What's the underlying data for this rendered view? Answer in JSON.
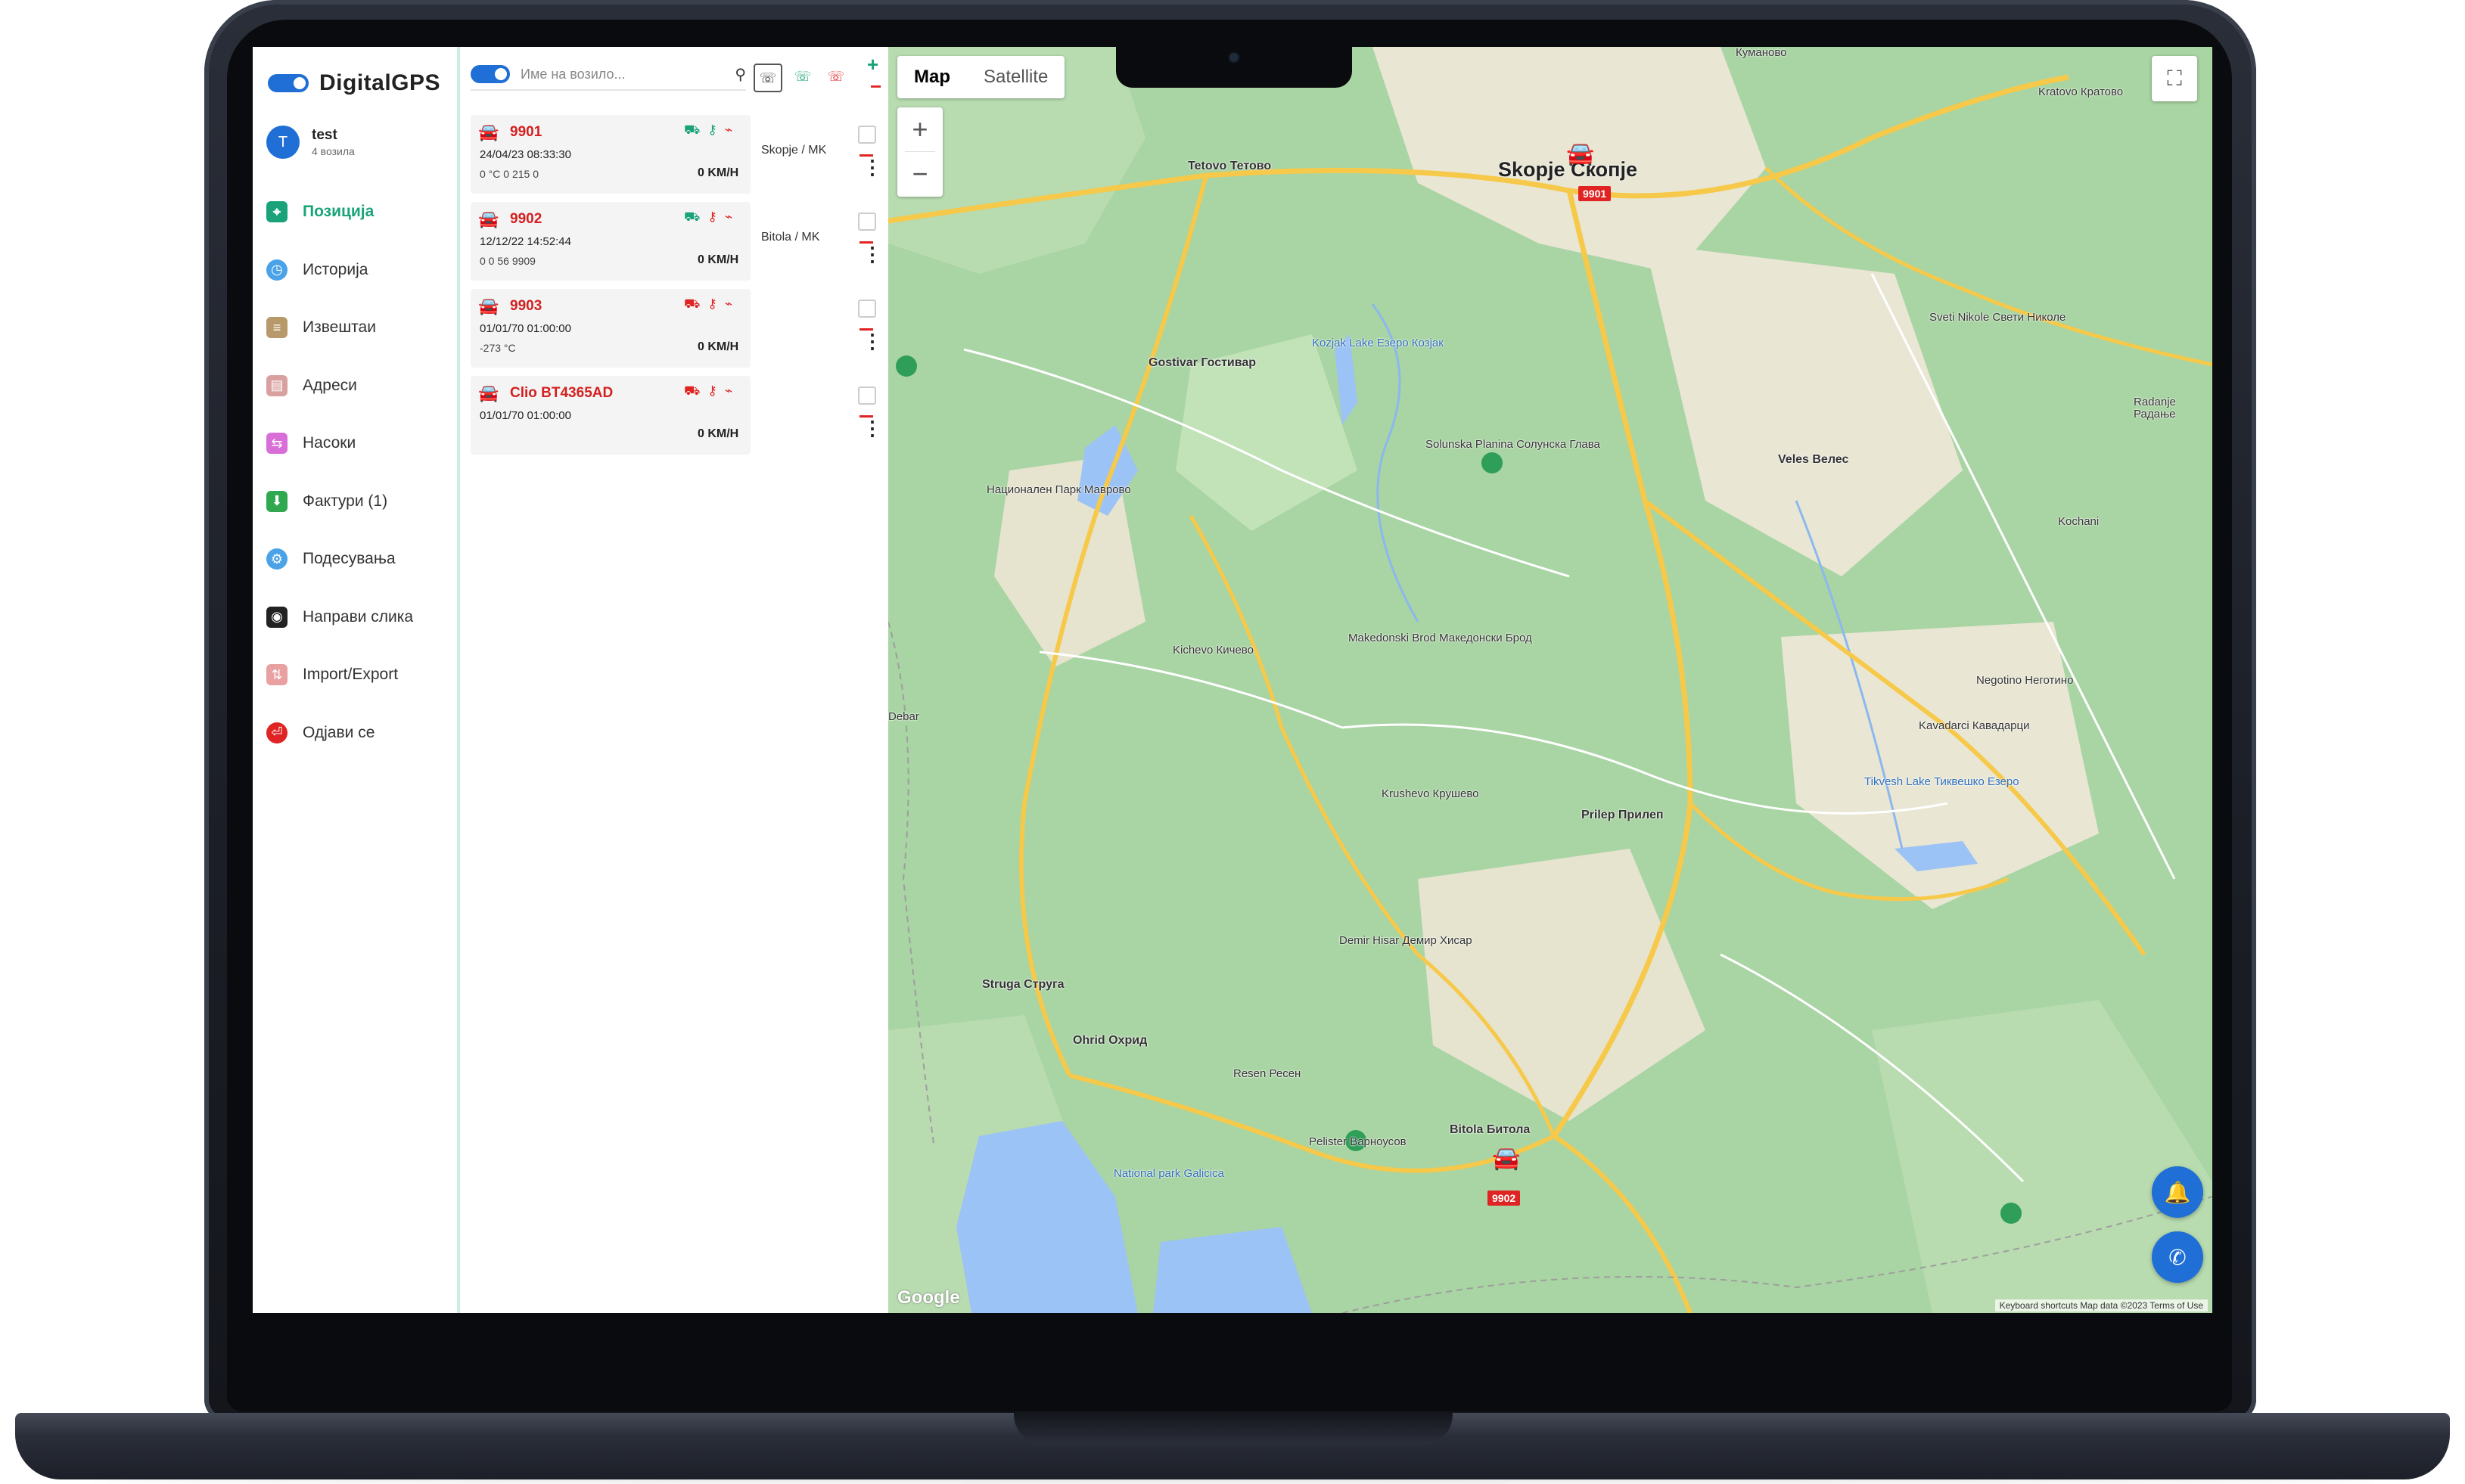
{
  "app": {
    "name": "DigitalGPS"
  },
  "user": {
    "initial": "T",
    "name": "test",
    "subtitle": "4 возила"
  },
  "menu": [
    {
      "label": "Позиција",
      "icon": "position-icon",
      "active": true,
      "color": "#1aa37a"
    },
    {
      "label": "Историја",
      "icon": "history-icon",
      "active": false,
      "color": "#4aa3e8"
    },
    {
      "label": "Извештаи",
      "icon": "reports-icon",
      "active": false,
      "color": "#b89a6a"
    },
    {
      "label": "Адреси",
      "icon": "addresses-icon",
      "active": false,
      "color": "#d9a0a0"
    },
    {
      "label": "Насоки",
      "icon": "directions-icon",
      "active": false,
      "color": "#d86fd8"
    },
    {
      "label": "Фактури (1)",
      "icon": "invoices-icon",
      "active": false,
      "color": "#2fa84f"
    },
    {
      "label": "Подесувања",
      "icon": "settings-icon",
      "active": false,
      "color": "#4aa3e8"
    },
    {
      "label": "Направи слика",
      "icon": "camera-icon",
      "active": false,
      "color": "#222222"
    },
    {
      "label": "Import/Export",
      "icon": "import-export-icon",
      "active": false,
      "color": "#e8a0a0"
    },
    {
      "label": "Одјави се",
      "icon": "logout-icon",
      "active": false,
      "color": "#e02424"
    }
  ],
  "search": {
    "placeholder": "Име на возило..."
  },
  "list_controls": {
    "plus": "+",
    "minus": "−"
  },
  "vehicles": [
    {
      "name": "9901",
      "time": "24/04/23 08:33:30",
      "sensors": "0 °C  0  215  0",
      "speed": "0 KM/H",
      "location": "Skopje / MK"
    },
    {
      "name": "9902",
      "time": "12/12/22 14:52:44",
      "sensors": "0  0  56  9909",
      "speed": "0 KM/H",
      "location": "Bitola / MK"
    },
    {
      "name": "9903",
      "time": "01/01/70 01:00:00",
      "sensors": "-273 °C",
      "speed": "0 KM/H",
      "location": ""
    },
    {
      "name": "Clio BT4365AD",
      "time": "01/01/70 01:00:00",
      "sensors": "",
      "speed": "0 KM/H",
      "location": ""
    }
  ],
  "map": {
    "tabs": [
      "Map",
      "Satellite"
    ],
    "active_tab": "Map",
    "zoom_in": "+",
    "zoom_out": "−",
    "google": "Google",
    "attribution": "Keyboard shortcuts   Map data ©2023   Terms of Use",
    "markers": [
      "9901",
      "9902"
    ],
    "places": {
      "skopje": "Skopje Скопје",
      "tetovo": "Tetovo Тетово",
      "kumanovo": "Куманово",
      "veles": "Veles Велес",
      "prilep": "Prilep Прилеп",
      "bitola": "Bitola Битола",
      "ohrid": "Ohrid Охрид",
      "struga": "Struga Струга",
      "kichevo": "Kichevo Кичево",
      "gostivar": "Gostivar Гостивар",
      "resen": "Resen Ресен",
      "krushevo": "Krushevo Крушево",
      "kavadarci": "Kavadarci Кавадарци",
      "negotino": "Negotino Неготино",
      "demir_hisar": "Demir Hisar Демир Хисар",
      "makedonski_brod": "Makedonski Brod Македонски Брод",
      "kozjak": "Kozjak Lake Езеро Козјак",
      "tikvesh": "Tikvesh Lake Тиквешко Езеро",
      "mavrovo": "Национален Парк Маврово",
      "galicica": "National park Galicica",
      "pelister": "Pelister Варноусов",
      "solunska": "Solunska Planina Солунска Глава",
      "debar": "Debar",
      "sveti_nikole": "Sveti Nikole Свети Николе",
      "kratovo": "Kratovo Кратово",
      "radovish": "Radanje Радање",
      "kochani": "Kochani"
    }
  }
}
